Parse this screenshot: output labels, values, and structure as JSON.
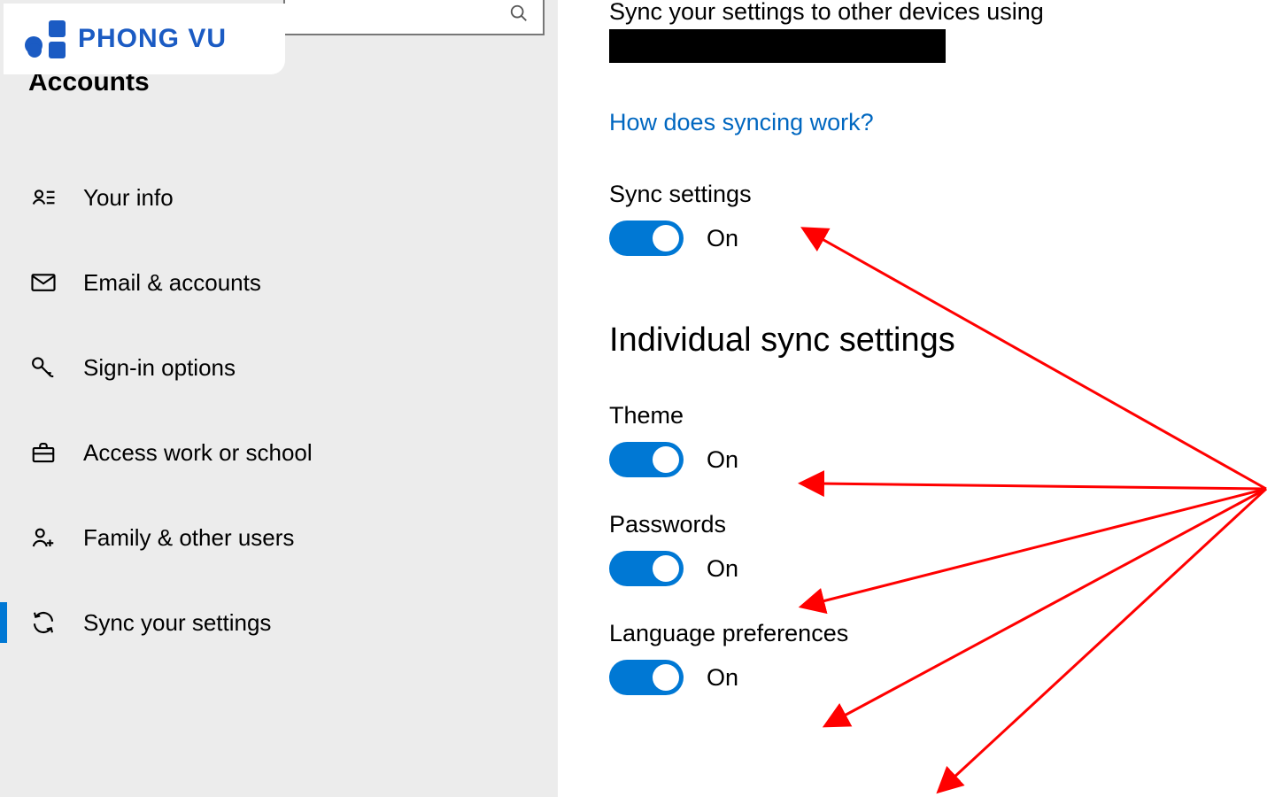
{
  "logo": {
    "text": "PHONG VU"
  },
  "sidebar": {
    "heading": "Accounts",
    "items": [
      {
        "label": "Your info",
        "icon": "person-card-icon"
      },
      {
        "label": "Email & accounts",
        "icon": "mail-icon"
      },
      {
        "label": "Sign-in options",
        "icon": "key-icon"
      },
      {
        "label": "Access work or school",
        "icon": "briefcase-icon"
      },
      {
        "label": "Family & other users",
        "icon": "people-add-icon"
      },
      {
        "label": "Sync your settings",
        "icon": "sync-icon"
      }
    ]
  },
  "content": {
    "intro": "Sync your settings to other devices using",
    "link": "How does syncing work?",
    "sync_settings_label": "Sync settings",
    "section_heading": "Individual sync settings",
    "items": [
      {
        "label": "Theme",
        "state": "On"
      },
      {
        "label": "Passwords",
        "state": "On"
      },
      {
        "label": "Language preferences",
        "state": "On"
      }
    ],
    "master_state": "On"
  },
  "colors": {
    "accent": "#0078d4",
    "link": "#0067c0",
    "arrow": "#ff0000",
    "brand": "#1b5bc3"
  }
}
